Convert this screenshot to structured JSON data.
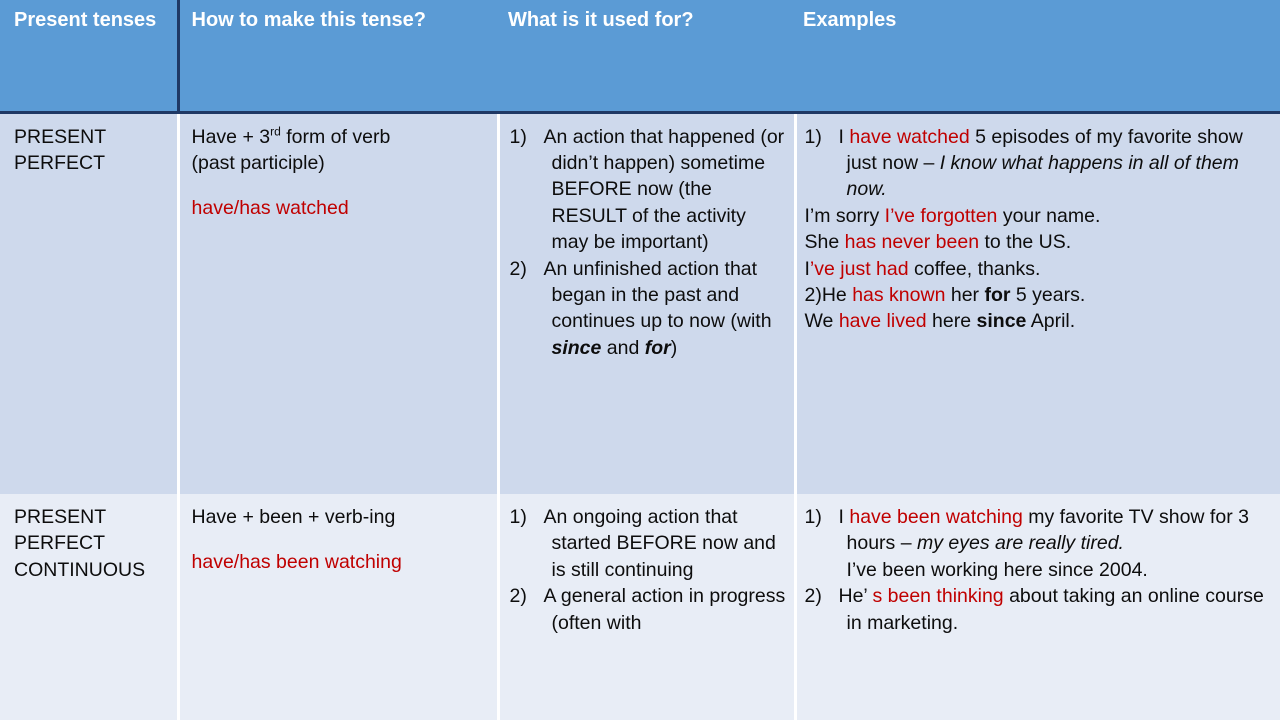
{
  "slide": {
    "title": "Present tenses — Present Perfect / Present Perfect Continuous",
    "colors": {
      "header_blue": "#5b9bd5",
      "header_border": "#1f3864",
      "row1_bg": "#ced9ec",
      "row2_bg": "#e8edf6",
      "accent_red": "#c00000",
      "text": "#0d0d0d"
    }
  },
  "header": {
    "col_tense": "Present tenses",
    "col_make": "How to make this tense?",
    "col_use": "What is it used for?",
    "col_examples": "Examples"
  },
  "rows": [
    {
      "tense_line1": "PRESENT",
      "tense_line2": "PERFECT",
      "make_formula_a": "Have + 3",
      "make_formula_sup": "rd",
      "make_formula_b": " form of verb",
      "make_formula_line2": "(past participle)",
      "make_example_red": "have/has watched",
      "use": [
        {
          "num": "1)",
          "text": "An action that happened (or didn’t happen) sometime BEFORE now (the RESULT of the activity may be important)"
        },
        {
          "num": "2)",
          "text_pre": "An unfinished action that began in the past and continues up to now (with ",
          "bold_italic_1": "since",
          "text_mid": " and ",
          "bold_italic_2": "for",
          "text_post": ")"
        }
      ],
      "examples": {
        "item1_num": "1)",
        "item1_pre": "I ",
        "item1_red": "have watched",
        "item1_mid": " 5 episodes of my favorite show just now – ",
        "item1_italic": "I know what happens in all of them now.",
        "line2_pre": "I’m sorry ",
        "line2_red": "I’ve forgotten",
        "line2_post": " your name.",
        "line3_pre": "She ",
        "line3_red": "has never been",
        "line3_post": " to the US.",
        "line4_pre": "I",
        "line4_red": "’ve just had",
        "line4_post": " coffee, thanks.",
        "item2_num": "2)",
        "item2_pre": "He ",
        "item2_red": "has known",
        "item2_mid": " her ",
        "item2_bold": "for",
        "item2_post": " 5 years.",
        "line6_pre": "We ",
        "line6_red": "have lived",
        "line6_mid": " here ",
        "line6_bold": "since",
        "line6_post": " April."
      }
    },
    {
      "tense_line1": "PRESENT",
      "tense_line2": "PERFECT",
      "tense_line3": "CONTINUOUS",
      "make_formula_a": "Have + been + verb-ing",
      "make_example_red": "have/has been watching",
      "use": [
        {
          "num": "1)",
          "text": "An ongoing action that started BEFORE now and is still continuing"
        },
        {
          "num": "2)",
          "text": "A general action in progress (often with"
        }
      ],
      "examples": {
        "item1_num": "1)",
        "item1_pre": "I ",
        "item1_red": "have been watching",
        "item1_mid": " my favorite TV show for 3 hours – ",
        "item1_italic": "my eyes are really tired.",
        "line2": "I’ve been working here since 2004.",
        "item2_num": "2)",
        "item2_pre": "He’",
        "item2_red": " s been thinking",
        "item2_post": " about taking an online course in marketing."
      }
    }
  ]
}
